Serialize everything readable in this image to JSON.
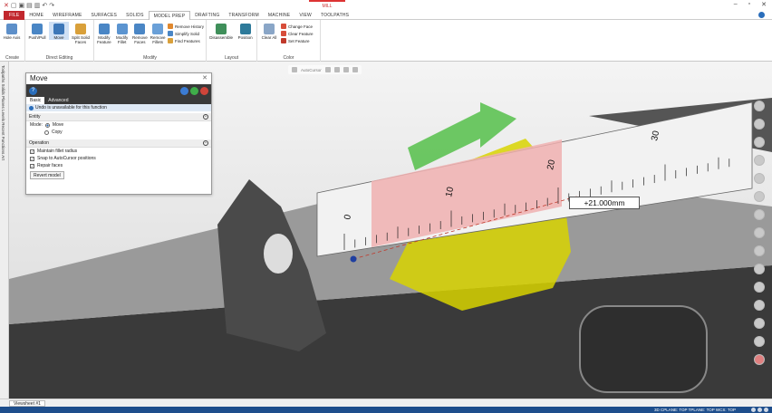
{
  "window": {
    "context_tab": "MILL",
    "controls": [
      "–",
      "▫",
      "✕"
    ]
  },
  "ribbon": {
    "tabs": [
      {
        "label": "FILE",
        "kind": "file"
      },
      {
        "label": "HOME"
      },
      {
        "label": "WIREFRAME"
      },
      {
        "label": "SURFACES"
      },
      {
        "label": "SOLIDS"
      },
      {
        "label": "MODEL PREP",
        "active": true
      },
      {
        "label": "DRAFTING"
      },
      {
        "label": "TRANSFORM"
      },
      {
        "label": "MACHINE"
      },
      {
        "label": "VIEW"
      },
      {
        "label": "TOOLPATHS"
      }
    ],
    "groups": {
      "create": {
        "label": "Create",
        "buttons": [
          "Hole Axis"
        ]
      },
      "direct_editing": {
        "label": "Direct Editing",
        "buttons": [
          "Push/Pull",
          "Move",
          "Split Solid Faces"
        ]
      },
      "modify": {
        "label": "Modify",
        "buttons": [
          "Modify Feature",
          "Modify Fillet",
          "Remove Faces",
          "Remove Fillets"
        ],
        "small": [
          "Remove History",
          "Simplify Solid",
          "Find Features"
        ]
      },
      "layout": {
        "label": "Layout",
        "buttons": [
          "Disassemble",
          "Position"
        ]
      },
      "color": {
        "label": "Color",
        "buttons": [
          "Clear All"
        ],
        "small": [
          "Change Face",
          "Clear Feature",
          "Set Feature"
        ]
      }
    }
  },
  "left_strip": {
    "text": "Toolpaths  Solids  Planes  Levels  Recent Functions  Art"
  },
  "viewport": {
    "toolbar_label": "AutoCursor",
    "measure_label": "+21.000mm",
    "ruler_ticks": [
      "0",
      "10",
      "20",
      "30"
    ]
  },
  "move_panel": {
    "title": "Move",
    "tabs": [
      "Basic",
      "Advanced"
    ],
    "info": "Undo is unavailable for this function",
    "entity_section": "Entity",
    "mode_label": "Mode:",
    "mode_options": [
      {
        "label": "Move",
        "selected": true
      },
      {
        "label": "Copy",
        "selected": false
      }
    ],
    "operation_section": "Operation",
    "checkboxes": [
      {
        "label": "Maintain fillet radius",
        "checked": true
      },
      {
        "label": "Snap to AutoCursor positions",
        "checked": true
      },
      {
        "label": "Repair faces",
        "checked": true
      }
    ],
    "revert_label": "Revert model"
  },
  "bottom": {
    "sheet_tab": "Viewsheet #1",
    "status": "3D  CPLANE: TOP    TPLANE: TOP    WCS: TOP"
  },
  "colors": {
    "file_tab": "#c1272d",
    "statusbar": "#1e4e8c",
    "arrow_green": "#55c04a",
    "ruler_pink": "#f0b0b0",
    "yellow_part": "#d8d400"
  }
}
